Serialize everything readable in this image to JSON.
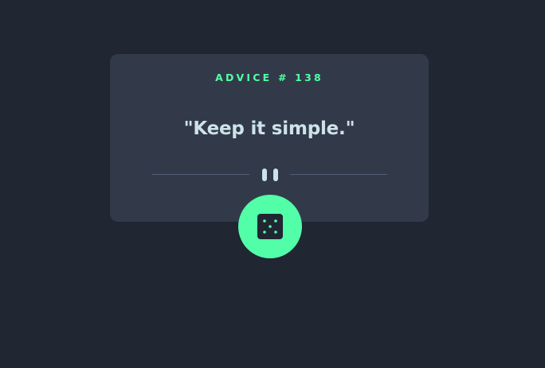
{
  "advice": {
    "label": "ADVICE # 138",
    "quote": "\"Keep it simple.\""
  },
  "icons": {
    "divider": "pause-icon",
    "button": "dice-icon"
  },
  "colors": {
    "background": "#202632",
    "card": "#323a49",
    "accent": "#52ffa8",
    "text": "#cee3e9",
    "divider": "#4f5d74"
  }
}
